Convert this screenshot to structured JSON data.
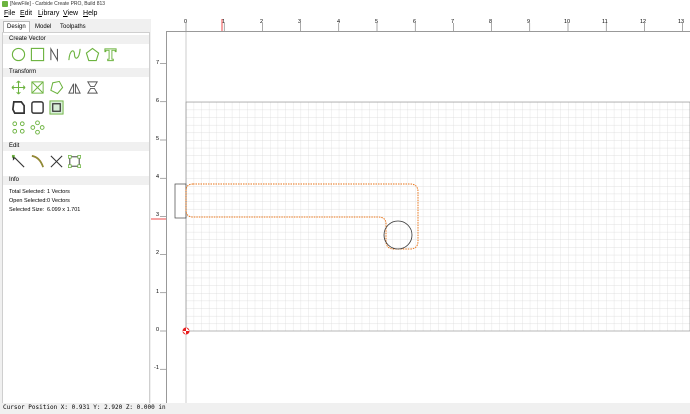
{
  "window": {
    "title": "[NewFile] - Carbide Create PRO, Build 813"
  },
  "menu": [
    "File",
    "Edit",
    "Library",
    "View",
    "Help"
  ],
  "tabs": [
    "Design",
    "Model",
    "Toolpaths"
  ],
  "sections": {
    "create_vector": "Create Vector",
    "transform": "Transform",
    "edit": "Edit",
    "info": "Info"
  },
  "info": {
    "total_selected_label": "Total Selected:",
    "total_selected_value": "1 Vectors",
    "open_selected_label": "Open Selected:",
    "open_selected_value": "0 Vectors",
    "selected_size_label": "Selected Size:",
    "selected_size_value": "6.099 x 1.701"
  },
  "ruler": {
    "x_labels": [
      "0",
      "1",
      "2",
      "3",
      "4",
      "5",
      "6",
      "7",
      "8",
      "9",
      "10",
      "11",
      "12",
      "13"
    ],
    "y_labels": [
      "7",
      "6",
      "5",
      "4",
      "3",
      "2",
      "1",
      "0",
      "-1"
    ]
  },
  "status": {
    "cursor": "Cursor Position X: 0.931 Y: 2.920 Z: 0.000 in"
  },
  "colors": {
    "accent": "#6cb33f",
    "selection": "#e8751a",
    "origin": "#e81e1e"
  }
}
